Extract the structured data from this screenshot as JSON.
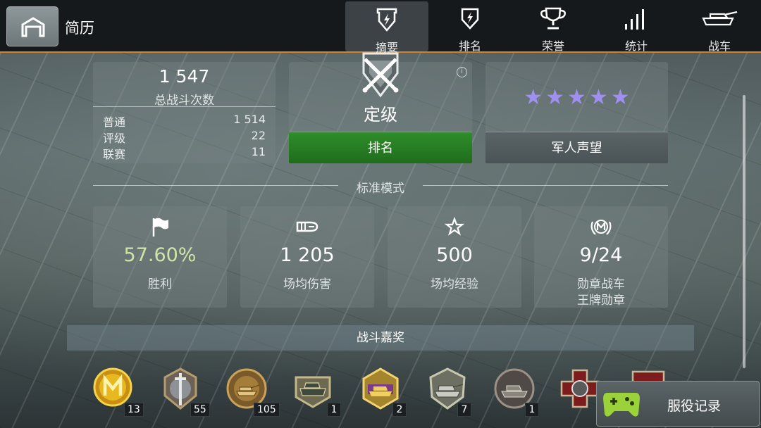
{
  "header": {
    "title": "简历",
    "tabs": [
      {
        "label": "摘要",
        "icon": "shield-bolt-icon",
        "active": true
      },
      {
        "label": "排名",
        "icon": "shield-swords-icon",
        "active": false
      },
      {
        "label": "荣誉",
        "icon": "trophy-icon",
        "active": false
      },
      {
        "label": "统计",
        "icon": "bar-chart-icon",
        "active": false
      },
      {
        "label": "战车",
        "icon": "tank-icon",
        "active": false
      }
    ]
  },
  "battles": {
    "total": "1 547",
    "total_label": "总战斗次数",
    "rows": [
      {
        "label": "普通",
        "value": "1 514"
      },
      {
        "label": "评级",
        "value": "22"
      },
      {
        "label": "联赛",
        "value": "11"
      }
    ]
  },
  "rank": {
    "title": "定级",
    "button": "排名",
    "info": "i"
  },
  "reputation": {
    "stars": 5,
    "star_glyph": "★",
    "button": "军人声望",
    "color": "#9f8ff0"
  },
  "mode_label": "标准模式",
  "stats": [
    {
      "icon": "flag-icon",
      "value": "57.60%",
      "label": "胜利",
      "label2": "",
      "color": "#cde6a8"
    },
    {
      "icon": "shell-icon",
      "value": "1 205",
      "label": "场均伤害",
      "label2": "",
      "color": "#ffffff"
    },
    {
      "icon": "star-outline-icon",
      "value": "500",
      "label": "场均经验",
      "label2": "",
      "color": "#ffffff"
    },
    {
      "icon": "mastery-badge-icon",
      "value": "9/24",
      "label": "勋章战车",
      "label2": "王牌勋章",
      "color": "#ffffff"
    }
  ],
  "awards_title": "战斗嘉奖",
  "medals": [
    {
      "name": "mastery-medal",
      "count": "13"
    },
    {
      "name": "sword-medal",
      "count": "55"
    },
    {
      "name": "tank-wreath-medal",
      "count": "105"
    },
    {
      "name": "heavy-tank-medal",
      "count": "1"
    },
    {
      "name": "gold-tank-medal",
      "count": "2"
    },
    {
      "name": "silver-tank-medal",
      "count": "7"
    },
    {
      "name": "dark-tank-medal",
      "count": "1"
    },
    {
      "name": "red-cross-medal",
      "count": ""
    },
    {
      "name": "red-medal",
      "count": ""
    }
  ],
  "service_record": "服役记录"
}
